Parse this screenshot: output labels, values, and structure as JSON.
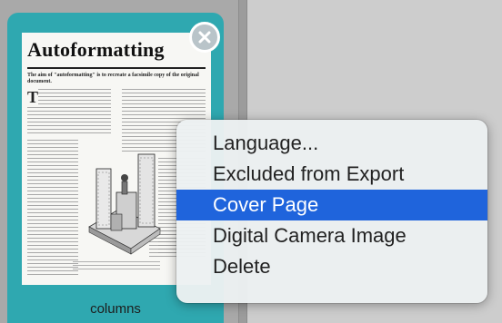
{
  "thumbnail": {
    "label": "columns",
    "document": {
      "title": "Autoformatting",
      "subtitle": "The aim of \"autoformatting\" is to recreate a facsimile copy of the original document.",
      "dropcap": "T"
    },
    "close_icon": "close-circle-icon"
  },
  "context_menu": {
    "items": [
      {
        "label": "Language...",
        "selected": false
      },
      {
        "label": "Excluded from Export",
        "selected": false
      },
      {
        "label": "Cover Page",
        "selected": true
      },
      {
        "label": "Digital Camera Image",
        "selected": false
      },
      {
        "label": "Delete",
        "selected": false
      }
    ],
    "highlight_color": "#1f64dc"
  },
  "colors": {
    "thumbnail_frame": "#2fa8b0",
    "left_pane": "#a9a9a9",
    "right_pane": "#cdcdcd"
  }
}
